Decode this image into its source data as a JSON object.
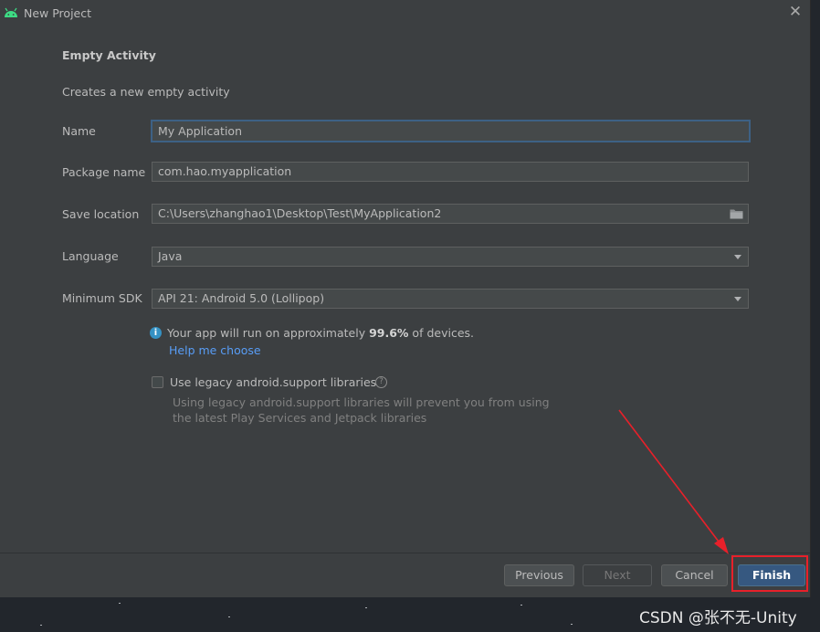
{
  "window": {
    "title": "New Project"
  },
  "header": {
    "heading": "Empty Activity",
    "description": "Creates a new empty activity"
  },
  "form": {
    "name": {
      "label": "Name",
      "value": "My Application"
    },
    "package": {
      "label": "Package name",
      "value": "com.hao.myapplication"
    },
    "save_location": {
      "label": "Save location",
      "value": "C:\\Users\\zhanghao1\\Desktop\\Test\\MyApplication2"
    },
    "language": {
      "label": "Language",
      "value": "Java"
    },
    "min_sdk": {
      "label": "Minimum SDK",
      "value": "API 21: Android 5.0 (Lollipop)"
    }
  },
  "info": {
    "text_prefix": "Your app will run on approximately ",
    "percent": "99.6%",
    "text_suffix": " of devices.",
    "help_link": "Help me choose"
  },
  "legacy": {
    "label": "Use legacy android.support libraries",
    "hint_line1": "Using legacy android.support libraries will prevent you from using",
    "hint_line2": "the latest Play Services and Jetpack libraries"
  },
  "buttons": {
    "previous": "Previous",
    "next": "Next",
    "cancel": "Cancel",
    "finish": "Finish"
  },
  "watermark": "CSDN @张不无-Unity",
  "colors": {
    "accent": "#365880",
    "focus": "#3d6185",
    "link": "#589df6",
    "annotation": "#e8202a",
    "android": "#3ddc84"
  }
}
